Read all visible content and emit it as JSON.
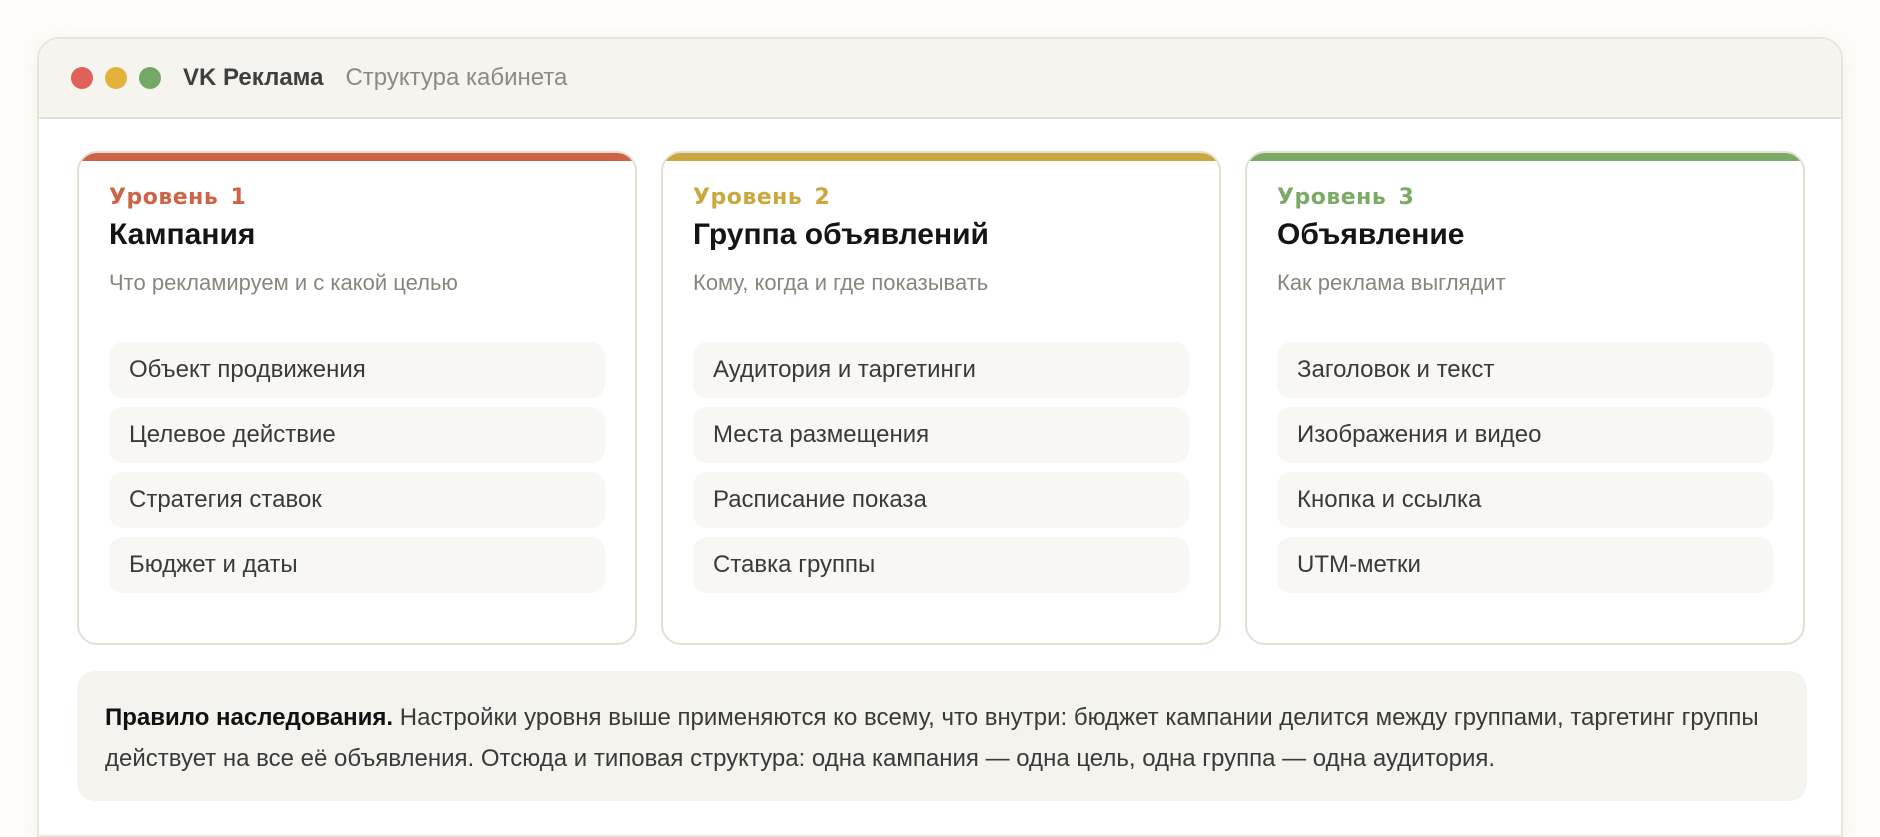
{
  "window": {
    "app_title": "VK Реклама",
    "subtitle": "Структура кабинета"
  },
  "levels": [
    {
      "label": "Уровень 1",
      "title": "Кампания",
      "description": "Что рекламируем и с какой целью",
      "accent": "#cc6445",
      "items": [
        "Объект продвижения",
        "Целевое действие",
        "Стратегия ставок",
        "Бюджет и даты"
      ]
    },
    {
      "label": "Уровень 2",
      "title": "Группа объявлений",
      "description": "Кому, когда и где показывать",
      "accent": "#c9a83e",
      "items": [
        "Аудитория и таргетинги",
        "Места размещения",
        "Расписание показа",
        "Ставка группы"
      ]
    },
    {
      "label": "Уровень 3",
      "title": "Объявление",
      "description": "Как реклама выглядит",
      "accent": "#7aaa66",
      "items": [
        "Заголовок и текст",
        "Изображения и видео",
        "Кнопка и ссылка",
        "UTM-метки"
      ]
    }
  ],
  "note": {
    "bold": "Правило наследования.",
    "text": " Настройки уровня выше применяются ко всему, что внутри: бюджет кампании делится между группами, таргетинг группы действует на все её объявления. Отсюда и типовая структура: одна кампания — одна цель, одна группа — одна аудитория."
  }
}
